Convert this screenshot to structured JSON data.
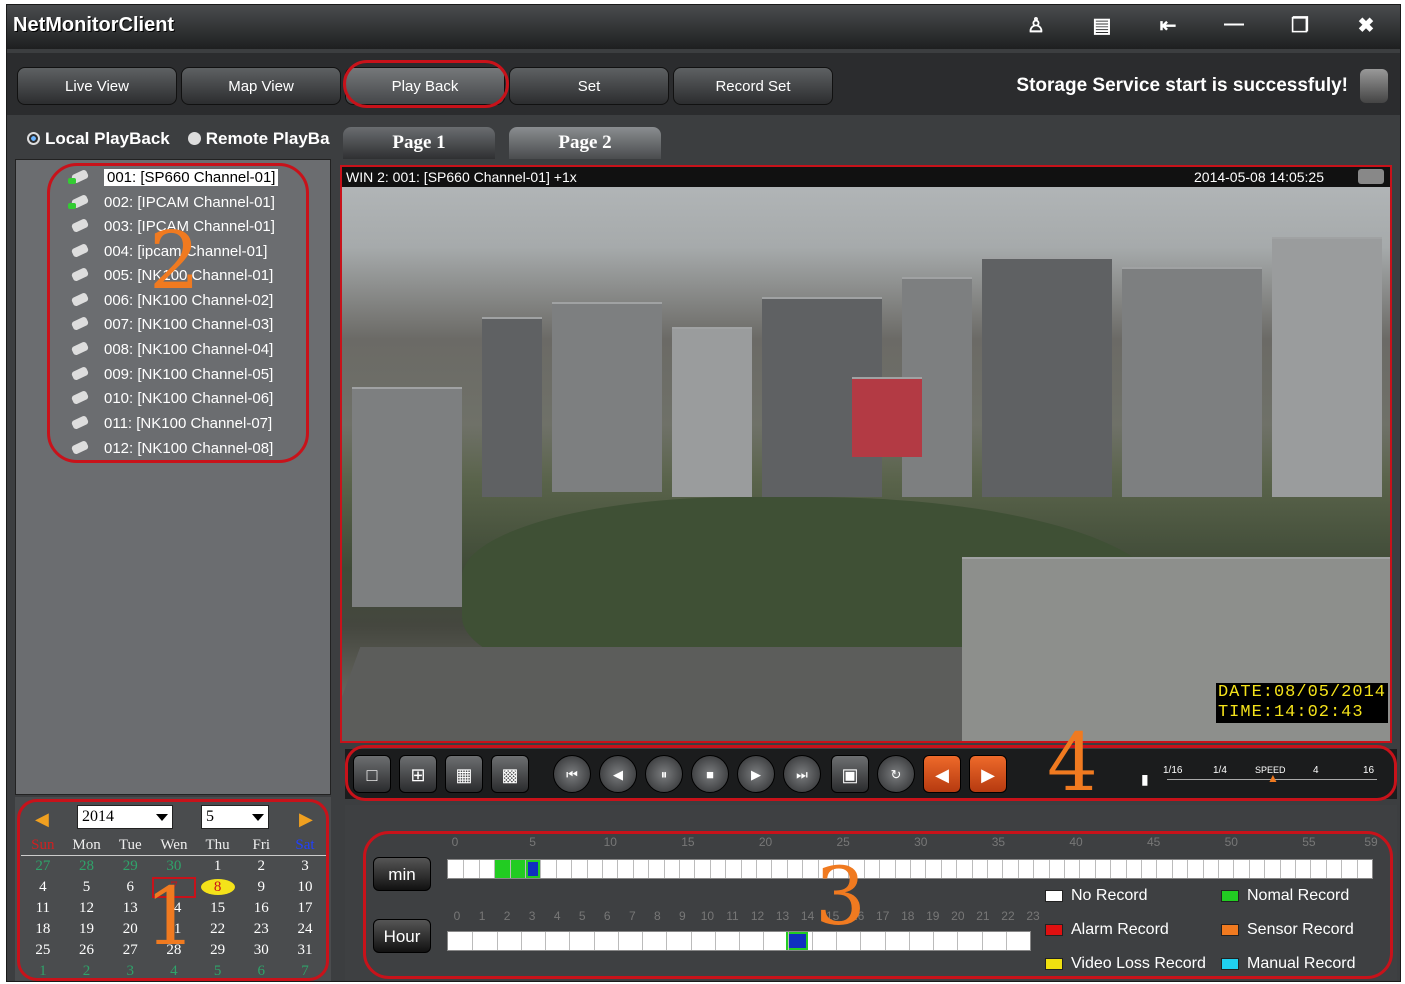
{
  "app": {
    "title": "NetMonitorClient"
  },
  "titlebar": {
    "icons": [
      "users-icon",
      "minimize-panel-icon",
      "login-icon",
      "minimize-icon",
      "restore-icon",
      "close-icon"
    ],
    "close_glyph": "✖"
  },
  "nav": {
    "tabs": [
      "Live View",
      "Map View",
      "Play Back",
      "Set",
      "Record Set"
    ],
    "active": "Play Back"
  },
  "status": {
    "message": "Storage Service start is successfuly!"
  },
  "playback_mode": {
    "local": "Local PlayBack",
    "remote": "Remote PlayBa",
    "selected": "local"
  },
  "channels": [
    {
      "label": "001: [SP660 Channel-01]",
      "active": true,
      "selected": true
    },
    {
      "label": "002: [IPCAM Channel-01]",
      "active": true
    },
    {
      "label": "003: [IPCAM Channel-01]"
    },
    {
      "label": "004: [ipcam Channel-01]"
    },
    {
      "label": "005: [NK100 Channel-01]"
    },
    {
      "label": "006: [NK100 Channel-02]"
    },
    {
      "label": "007: [NK100 Channel-03]"
    },
    {
      "label": "008: [NK100 Channel-04]"
    },
    {
      "label": "009: [NK100 Channel-05]"
    },
    {
      "label": "010: [NK100 Channel-06]"
    },
    {
      "label": "011: [NK100 Channel-07]"
    },
    {
      "label": "012: [NK100 Channel-08]"
    }
  ],
  "calendar": {
    "year": "2014",
    "month": "5",
    "weekdays": [
      "Sun",
      "Mon",
      "Tue",
      "Wen",
      "Thu",
      "Fri",
      "Sat"
    ],
    "weeks": [
      [
        "27",
        "28",
        "29",
        "30",
        "1",
        "2",
        "3"
      ],
      [
        "4",
        "5",
        "6",
        "7",
        "8",
        "9",
        "10"
      ],
      [
        "11",
        "12",
        "13",
        "14",
        "15",
        "16",
        "17"
      ],
      [
        "18",
        "19",
        "20",
        "21",
        "22",
        "23",
        "24"
      ],
      [
        "25",
        "26",
        "27",
        "28",
        "29",
        "30",
        "31"
      ],
      [
        "1",
        "2",
        "3",
        "4",
        "5",
        "6",
        "7"
      ]
    ],
    "today": "8",
    "selected": "7"
  },
  "pages": [
    "Page 1",
    "Page 2"
  ],
  "video": {
    "window_label": "WIN 2: 001: [SP660 Channel-01] +1x",
    "timestamp": "2014-05-08 14:05:25",
    "osd_date": "DATE:08/05/2014",
    "osd_time": "TIME:14:02:43"
  },
  "controls": {
    "layout_buttons": [
      "layout-1-icon",
      "layout-4-icon",
      "layout-9-icon",
      "layout-16-icon"
    ],
    "playback_buttons": [
      "⏮",
      "◀",
      "⏸",
      "■",
      "▶",
      "⏭"
    ],
    "speed": {
      "label": "SPEED",
      "marks": [
        "1/16",
        "1/4",
        "",
        "4",
        "16"
      ]
    }
  },
  "timeline": {
    "min_label": "min",
    "hour_label": "Hour",
    "min_ticks": [
      "0",
      "5",
      "10",
      "15",
      "20",
      "25",
      "30",
      "35",
      "40",
      "45",
      "50",
      "55",
      "59"
    ],
    "hour_ticks": [
      "0",
      "1",
      "2",
      "3",
      "4",
      "5",
      "6",
      "7",
      "8",
      "9",
      "10",
      "11",
      "12",
      "13",
      "14",
      "15",
      "16",
      "17",
      "18",
      "19",
      "20",
      "21",
      "22",
      "23"
    ],
    "legend": [
      {
        "label": "No Record",
        "color": "#ffffff"
      },
      {
        "label": "Nomal Record",
        "color": "#22cc22"
      },
      {
        "label": "Alarm Record",
        "color": "#e01010"
      },
      {
        "label": "Sensor Record",
        "color": "#f07a20"
      },
      {
        "label": "Video Loss Record",
        "color": "#f0e010"
      },
      {
        "label": "Manual Record",
        "color": "#20d0f0"
      }
    ]
  },
  "markers": [
    "1",
    "2",
    "3",
    "4"
  ]
}
